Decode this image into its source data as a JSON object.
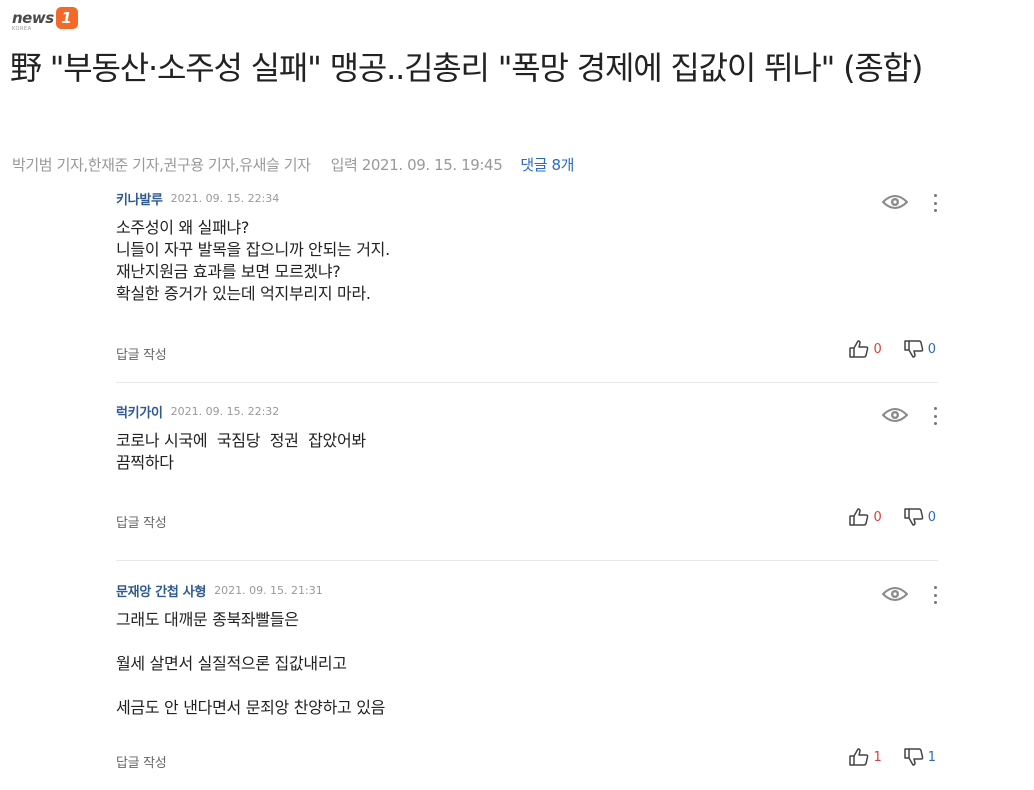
{
  "brand": {
    "logo_text": "news",
    "logo_badge": "1",
    "logo_sub": "KOREA"
  },
  "article": {
    "title": "野 \"부동산·소주성 실패\" 맹공..김총리 \"폭망 경제에 집값이 뛰나\" (종합)",
    "authors": "박기범 기자,한재준 기자,권구용 기자,유새슬 기자",
    "date": "입력 2021. 09. 15. 19:45",
    "comment_link": "댓글 8개"
  },
  "comments": [
    {
      "author": "키나발루",
      "time": "2021. 09. 15. 22:34",
      "body": "소주성이 왜 실패냐?\n니들이 자꾸 발목을 잡으니까 안되는 거지.\n재난지원금 효과를 보면 모르겠냐?\n확실한 증거가 있는데 억지부리지 마라.",
      "reply_label": "답글 작성",
      "likes": "0",
      "dislikes": "0"
    },
    {
      "author": "럭키가이",
      "time": "2021. 09. 15. 22:32",
      "body": "코로나 시국에  국짐당  정권  잡았어봐\n끔찍하다",
      "reply_label": "답글 작성",
      "likes": "0",
      "dislikes": "0"
    },
    {
      "author": "문재앙 간첩 사형",
      "time": "2021. 09. 15. 21:31",
      "body": "그래도 대깨문 종북좌빨들은\n\n월세 살면서 실질적으론 집값내리고\n\n세금도 안 낸다면서 문죄앙 찬양하고 있음",
      "reply_label": "답글 작성",
      "likes": "1",
      "dislikes": "1"
    }
  ],
  "colors": {
    "brand_orange": "#f2692a",
    "author_blue": "#2f5a91",
    "link_blue": "#2a6bc1",
    "like_red": "#e23b3b",
    "meta_gray": "#999999"
  },
  "icons": {
    "view": "eye-icon",
    "menu": "more-vertical-icon",
    "like": "thumbs-up-icon",
    "dislike": "thumbs-down-icon"
  }
}
